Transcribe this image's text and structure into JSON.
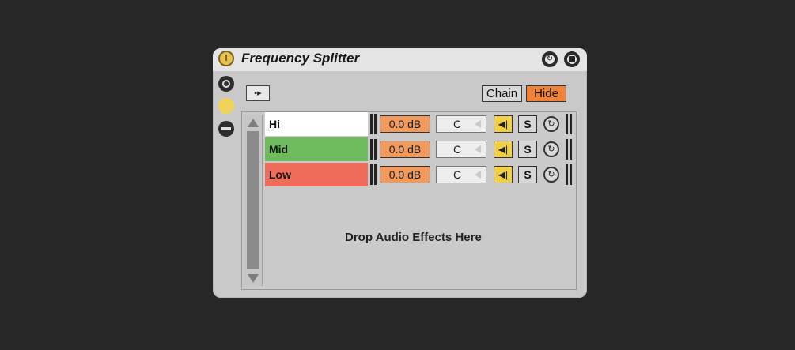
{
  "device": {
    "title": "Frequency Splitter",
    "power_icon": "power-icon",
    "hotswap_icon": "hotswap-icon",
    "save_icon": "save-icon"
  },
  "sidebar": {
    "icons": [
      "chain-view-icon",
      "macro-icon",
      "mixer-icon"
    ]
  },
  "toolbar": {
    "route_label": "→",
    "chain_label": "Chain",
    "hide_label": "Hide"
  },
  "chains": [
    {
      "name": "Hi",
      "volume": "0.0 dB",
      "pan": "C",
      "solo_label": "S",
      "color": "#ffffff"
    },
    {
      "name": "Mid",
      "volume": "0.0 dB",
      "pan": "C",
      "solo_label": "S",
      "color": "#6dbb5d"
    },
    {
      "name": "Low",
      "volume": "0.0 dB",
      "pan": "C",
      "solo_label": "S",
      "color": "#ef6b5a"
    }
  ],
  "drop_zone": {
    "text": "Drop Audio Effects Here"
  },
  "colors": {
    "background": "#272727",
    "device_bg": "#c9c9c9",
    "accent_orange": "#f1823a",
    "volume_orange": "#f29a5e",
    "activator_yellow": "#f1cf46"
  }
}
